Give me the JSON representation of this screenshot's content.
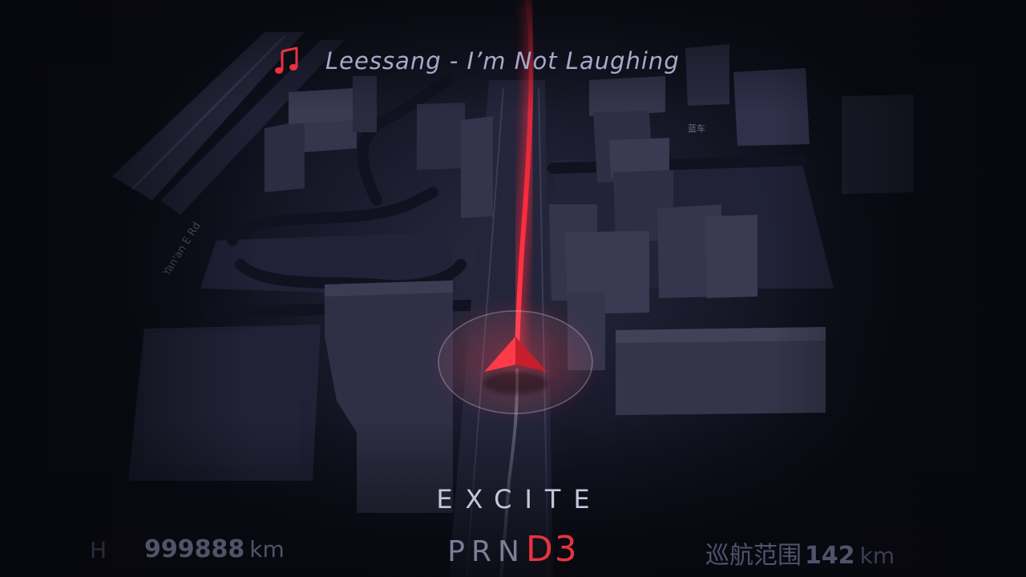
{
  "now_playing": {
    "icon": "music-note-icon",
    "track": "Leessang - I’m Not Laughing"
  },
  "map": {
    "street_label": "Yan'an E Rd",
    "sign_label": "蓝车"
  },
  "drive_mode": "EXCITE",
  "gear": {
    "inactive": "PRN",
    "active": "D3"
  },
  "odometer": {
    "prefix": "H",
    "value": "999888",
    "unit": "km"
  },
  "cruise_range": {
    "label": "巡航范围",
    "value": "142",
    "unit": "km"
  },
  "colors": {
    "accent": "#e8333f",
    "route": "#ff2a3c",
    "text_primary": "#c4c6db",
    "text_dim": "#50536a",
    "building": "#2e2e44"
  }
}
